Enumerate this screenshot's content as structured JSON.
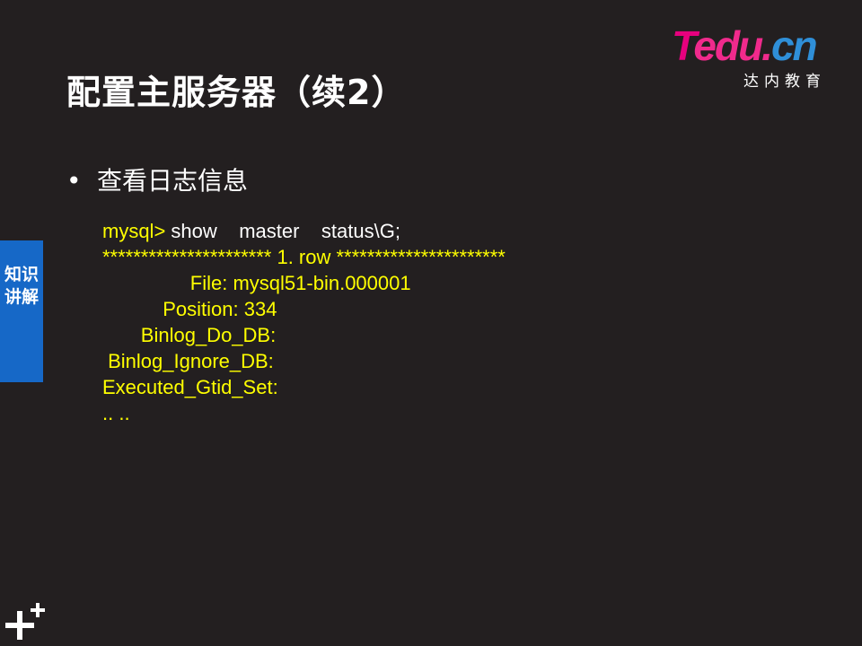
{
  "slide": {
    "title": "配置主服务器（续2）",
    "bullet": "查看日志信息",
    "side_tab": "知识讲解",
    "logo": {
      "brand_t": "T",
      "brand_edu": "edu.",
      "brand_cn": "cn",
      "subtitle": "达内教育"
    },
    "code": {
      "prompt": "mysql>",
      "command": " show    master    status\\G;",
      "lines": [
        "********************** 1. row **********************",
        "                File: mysql51-bin.000001",
        "           Position: 334",
        "       Binlog_Do_DB:",
        " Binlog_Ignore_DB:",
        "Executed_Gtid_Set:",
        ".. .."
      ]
    }
  },
  "colors": {
    "background": "#231f20",
    "title": "#ffffff",
    "code": "#ffff00",
    "side_tab": "#1668c7",
    "logo_pink": "#e6007e",
    "logo_blue": "#2f8fd8"
  },
  "icons": [
    "plus-plus-icon"
  ]
}
